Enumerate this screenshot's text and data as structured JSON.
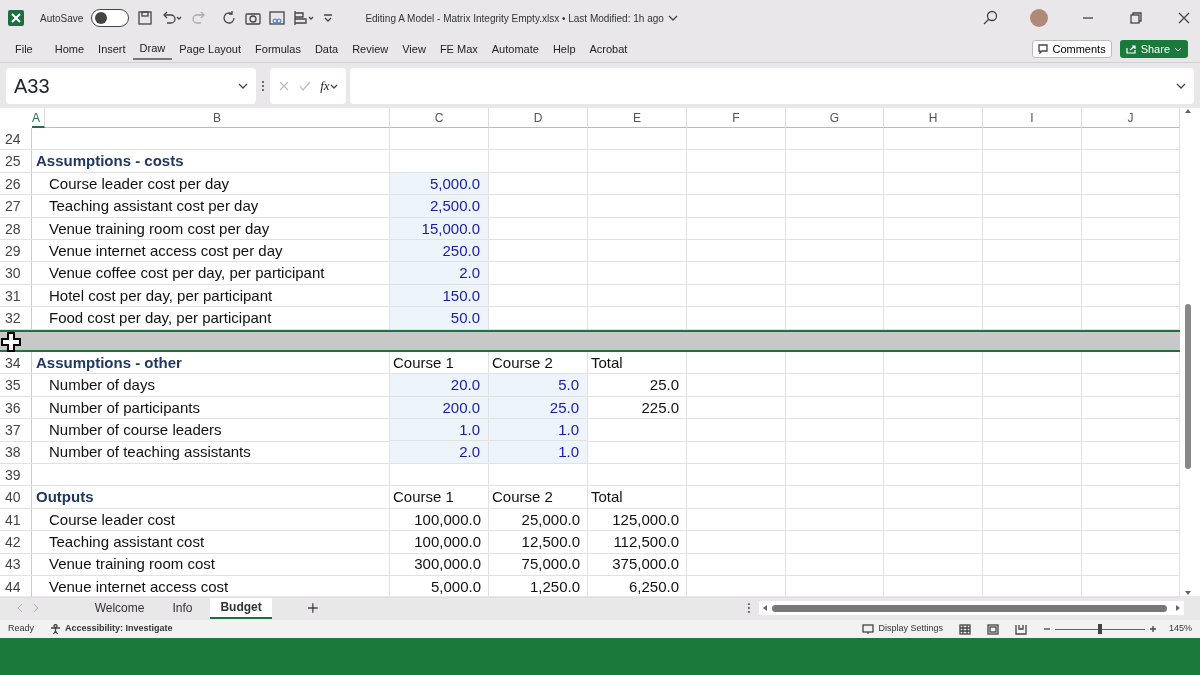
{
  "titlebar": {
    "autosave_label": "AutoSave",
    "autosave_on": false,
    "title": "Editing A Model - Matrix Integrity Empty.xlsx • Last Modified: 1h ago"
  },
  "ribbon_tabs": [
    {
      "label": "File",
      "selected": false
    },
    {
      "label": "Home",
      "selected": false
    },
    {
      "label": "Insert",
      "selected": false
    },
    {
      "label": "Draw",
      "selected": true
    },
    {
      "label": "Page Layout",
      "selected": false
    },
    {
      "label": "Formulas",
      "selected": false
    },
    {
      "label": "Data",
      "selected": false
    },
    {
      "label": "Review",
      "selected": false
    },
    {
      "label": "View",
      "selected": false
    },
    {
      "label": "FE Max",
      "selected": false
    },
    {
      "label": "Automate",
      "selected": false
    },
    {
      "label": "Help",
      "selected": false
    },
    {
      "label": "Acrobat",
      "selected": false
    }
  ],
  "comments_button": "Comments",
  "share_button": "Share",
  "name_box": "A33",
  "formula_icon": "fx",
  "columns": [
    {
      "label": "A",
      "selected": true
    },
    {
      "label": "B",
      "selected": false
    },
    {
      "label": "C",
      "selected": false
    },
    {
      "label": "D",
      "selected": false
    },
    {
      "label": "E",
      "selected": false
    },
    {
      "label": "F",
      "selected": false
    },
    {
      "label": "G",
      "selected": false
    },
    {
      "label": "H",
      "selected": false
    },
    {
      "label": "I",
      "selected": false
    },
    {
      "label": "J",
      "selected": false
    }
  ],
  "rows": [
    {
      "number": "24",
      "kind": "blank",
      "selected": false
    },
    {
      "number": "25",
      "kind": "heading",
      "label": "Assumptions - costs",
      "selected": false
    },
    {
      "number": "26",
      "kind": "item",
      "label": "Course leader cost per day",
      "selected": false,
      "c": {
        "text": "5,000.0",
        "input": true
      }
    },
    {
      "number": "27",
      "kind": "item",
      "label": "Teaching assistant cost per day",
      "selected": false,
      "c": {
        "text": "2,500.0",
        "input": true
      }
    },
    {
      "number": "28",
      "kind": "item",
      "label": "Venue training room cost per day",
      "selected": false,
      "c": {
        "text": "15,000.0",
        "input": true
      }
    },
    {
      "number": "29",
      "kind": "item",
      "label": "Venue internet access cost per day",
      "selected": false,
      "c": {
        "text": "250.0",
        "input": true
      }
    },
    {
      "number": "30",
      "kind": "item",
      "label": "Venue coffee cost per day, per participant",
      "selected": false,
      "c": {
        "text": "2.0",
        "input": true
      }
    },
    {
      "number": "31",
      "kind": "item",
      "label": "Hotel cost per day, per participant",
      "selected": false,
      "c": {
        "text": "150.0",
        "input": true
      }
    },
    {
      "number": "32",
      "kind": "item",
      "label": "Food cost per day, per participant",
      "selected": false,
      "c": {
        "text": "50.0",
        "input": true
      }
    },
    {
      "selected": true
    },
    {
      "number": "34",
      "kind": "heading",
      "label": "Assumptions - other",
      "selected": false,
      "c": {
        "text": "Course 1",
        "input": false
      },
      "d": {
        "text": "Course 2",
        "input": false
      },
      "e": {
        "text": "Total",
        "input": false
      }
    },
    {
      "number": "35",
      "kind": "item",
      "label": "Number of days",
      "selected": false,
      "c": {
        "text": "20.0",
        "input": true
      },
      "d": {
        "text": "5.0",
        "input": true
      },
      "e": {
        "text": "25.0",
        "input": false
      }
    },
    {
      "number": "36",
      "kind": "item",
      "label": "Number of participants",
      "selected": false,
      "c": {
        "text": "200.0",
        "input": true
      },
      "d": {
        "text": "25.0",
        "input": true
      },
      "e": {
        "text": "225.0",
        "input": false
      }
    },
    {
      "number": "37",
      "kind": "item",
      "label": "Number of course leaders",
      "selected": false,
      "c": {
        "text": "1.0",
        "input": true
      },
      "d": {
        "text": "1.0",
        "input": true
      }
    },
    {
      "number": "38",
      "kind": "item",
      "label": "Number of teaching assistants",
      "selected": false,
      "c": {
        "text": "2.0",
        "input": true
      },
      "d": {
        "text": "1.0",
        "input": true
      }
    },
    {
      "number": "39",
      "kind": "blank",
      "selected": false
    },
    {
      "number": "40",
      "kind": "heading",
      "label": "Outputs",
      "selected": false,
      "c": {
        "text": "Course 1",
        "input": false
      },
      "d": {
        "text": "Course 2",
        "input": false
      },
      "e": {
        "text": "Total",
        "input": false
      }
    },
    {
      "number": "41",
      "kind": "item",
      "label": "Course leader cost",
      "selected": false,
      "c": {
        "text": "100,000.0",
        "input": false
      },
      "d": {
        "text": "25,000.0",
        "input": false
      },
      "e": {
        "text": "125,000.0",
        "input": false
      }
    },
    {
      "number": "42",
      "kind": "item",
      "label": "Teaching assistant cost",
      "selected": false,
      "c": {
        "text": "100,000.0",
        "input": false
      },
      "d": {
        "text": "12,500.0",
        "input": false
      },
      "e": {
        "text": "112,500.0",
        "input": false
      }
    },
    {
      "number": "43",
      "kind": "item",
      "label": "Venue training room cost",
      "selected": false,
      "c": {
        "text": "300,000.0",
        "input": false
      },
      "d": {
        "text": "75,000.0",
        "input": false
      },
      "e": {
        "text": "375,000.0",
        "input": false
      }
    },
    {
      "number": "44",
      "kind": "item",
      "label": "Venue internet access cost",
      "selected": false,
      "c": {
        "text": "5,000.0",
        "input": false
      },
      "d": {
        "text": "1,250.0",
        "input": false
      },
      "e": {
        "text": "6,250.0",
        "input": false
      }
    }
  ],
  "sheet_tabs": [
    {
      "label": "Welcome",
      "selected": false
    },
    {
      "label": "Info",
      "selected": false
    },
    {
      "label": "Budget",
      "selected": true
    }
  ],
  "status": {
    "ready": "Ready",
    "accessibility": "Accessibility: Investigate",
    "display_settings": "Display Settings",
    "zoom": {
      "level": 0.5,
      "reading": "145%"
    }
  }
}
